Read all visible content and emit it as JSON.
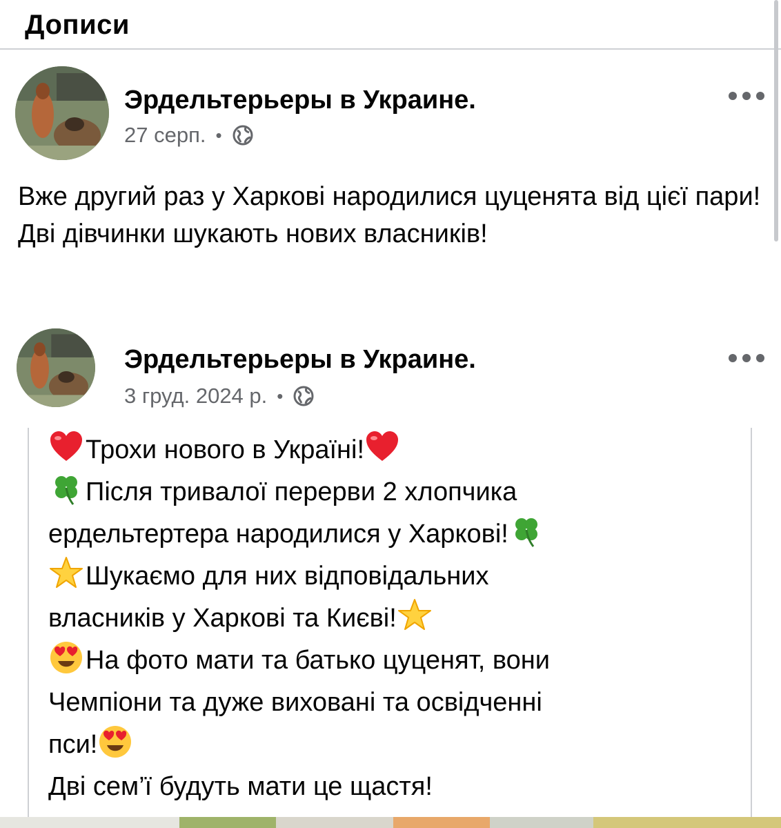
{
  "section": {
    "title": "Дописи"
  },
  "posts": [
    {
      "author": "Эрдельтерьеры в Украине.",
      "date": "27 серп.",
      "separator": "•",
      "privacy_icon": "globe-icon",
      "more_icon": "more-horizontal-icon",
      "text": "Вже другий раз у Харкові народилися цуценята від цієї пари! Дві дівчинки шукають нових власників!"
    },
    {
      "author": "Эрдельтерьеры в Украине.",
      "date": "3 груд. 2024 р.",
      "separator": "•",
      "privacy_icon": "globe-icon",
      "more_icon": "more-horizontal-icon",
      "lines": [
        "Трохи нового в Україні!",
        "Після тривалої перерви 2 хлопчика",
        "ердельтертера народилися у Харкові!",
        "Шукаємо для них відповідальних",
        "власників у Харкові та Києві!",
        "На фото мати та батько цуценят, вони",
        "Чемпіони та дуже виховані та освідченні",
        "пси!",
        "Дві сем’ї будуть мати це щастя!"
      ],
      "emojis": [
        "heart-icon",
        "four-leaf-clover-icon",
        "star-icon",
        "heart-eyes-icon"
      ]
    }
  ],
  "colors": {
    "text": "#050505",
    "secondary": "#65676b",
    "divider": "#ced0d4"
  }
}
